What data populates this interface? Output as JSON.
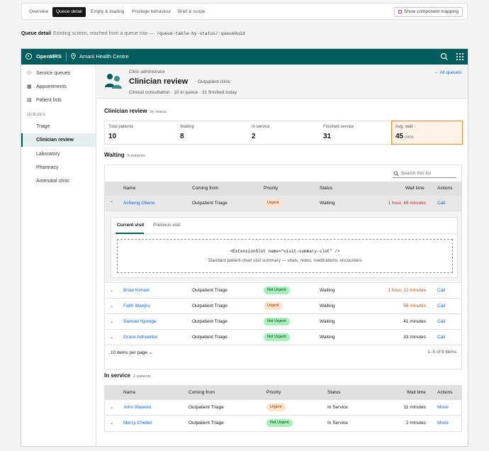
{
  "tabs": [
    "Overview",
    "Queue detail",
    "Empty & loading",
    "Privilege behaviour",
    "Brief & scope"
  ],
  "active_tab": "Queue detail",
  "mapping_button": "Show component mapping",
  "screen_label": {
    "title": "Queue detail",
    "desc": "Existing screen, reached from a queue row —",
    "route": "/queue-table-by-status/:queueUuid"
  },
  "header": {
    "brand": "OpenMRS",
    "location": "Amani Health Centre"
  },
  "sidebar": {
    "items": [
      {
        "label": "Service queues",
        "icon": "people-icon"
      },
      {
        "label": "Appointments",
        "icon": "calendar-icon"
      },
      {
        "label": "Patient lists",
        "icon": "list-icon"
      }
    ],
    "section": "QUEUES",
    "queues": [
      "Triage",
      "Clinician review",
      "Laboratory",
      "Pharmacy",
      "Antenatal clinic"
    ],
    "active_queue": "Clinician review"
  },
  "banner": {
    "role": "Clinic administrator",
    "title": "Clinician review",
    "subtitle": "· Outpatient clinic",
    "meta": "Clinical consultation · 10 in queue · 31 finished today",
    "all_queues": "← All queues"
  },
  "status_section": {
    "title": "Clinician review",
    "sub": "by status"
  },
  "metrics": [
    {
      "label": "Total patients",
      "value": "10"
    },
    {
      "label": "Waiting",
      "value": "8"
    },
    {
      "label": "In service",
      "value": "2"
    },
    {
      "label": "Finished service",
      "value": "31"
    },
    {
      "label": "Avg. wait",
      "arrow": "↑",
      "value": "45",
      "unit": "mins"
    }
  ],
  "waiting": {
    "title": "Waiting",
    "count": "8 patients",
    "search_placeholder": "Search this list",
    "columns": [
      "Name",
      "Coming from",
      "Priority",
      "Status",
      "Wait time",
      "Actions"
    ],
    "rows": [
      {
        "name": "Achieng Otieno",
        "from": "Outpatient Triage",
        "priority": "Urgent",
        "status": "Waiting",
        "wait": "1 hour, 48 minutes",
        "action": "Call",
        "level": "red"
      },
      {
        "name": "Brian Kimani",
        "from": "Outpatient Triage",
        "priority": "Not Urgent",
        "status": "Waiting",
        "wait": "1 hour, 12 minutes",
        "action": "Call",
        "level": "orange"
      },
      {
        "name": "Faith Wanjiru",
        "from": "Outpatient Triage",
        "priority": "Urgent",
        "status": "Waiting",
        "wait": "58 minutes",
        "action": "Call",
        "level": "orange"
      },
      {
        "name": "Samuel Njoroge",
        "from": "Outpatient Triage",
        "priority": "Not Urgent",
        "status": "Waiting",
        "wait": "41 minutes",
        "action": "Call",
        "level": "normal"
      },
      {
        "name": "Grace Adhiambo",
        "from": "Outpatient Triage",
        "priority": "Not Urgent",
        "status": "Waiting",
        "wait": "33 minutes",
        "action": "Call",
        "level": "normal"
      }
    ],
    "expanded": {
      "tabs": [
        "Current visit",
        "Previous visit"
      ],
      "slot_code": "<ExtensionSlot name=\"visit-summary-slot\" />",
      "slot_desc": "Standard patient-chart visit summary — vitals, notes, medications, encounters"
    },
    "pager": {
      "per_page": "10 items per page ⌄",
      "range": "1–5 of 8 items"
    }
  },
  "in_service": {
    "title": "In service",
    "count": "2 patients",
    "columns": [
      "Name",
      "Coming from",
      "Priority",
      "Status",
      "Wait time",
      "Actions"
    ],
    "rows": [
      {
        "name": "John Waweru",
        "from": "Outpatient Triage",
        "priority": "Urgent",
        "status": "In Service",
        "wait": "11 minutes",
        "action": "Move"
      },
      {
        "name": "Mercy Chebet",
        "from": "Outpatient Triage",
        "priority": "Not Urgent",
        "status": "In Service",
        "wait": "2 minutes",
        "action": "Move"
      }
    ]
  }
}
